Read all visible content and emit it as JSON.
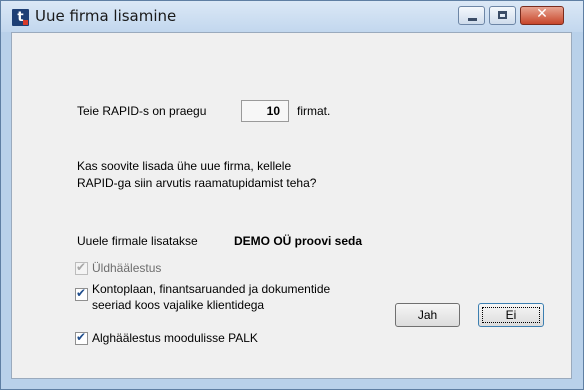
{
  "window": {
    "title": "Uue firma lisamine",
    "icon": "rapid-app-icon",
    "controls": {
      "minimize": "minimize-icon",
      "maximize": "maximize-icon",
      "close": "close-icon"
    }
  },
  "count_line": {
    "prefix": "Teie RAPID-s on  praegu",
    "value": "10",
    "suffix": "firmat."
  },
  "question": {
    "line1": "Kas soovite lisada ühe uue firma, kellele",
    "line2": "RAPID-ga siin arvutis raamatupidamist teha?"
  },
  "new_company": {
    "label": "Uuele firmale lisatakse",
    "name": "DEMO OÜ proovi seda"
  },
  "options": {
    "general": {
      "label": "Üldhäälestus",
      "checked": true,
      "enabled": false
    },
    "chart": {
      "line1": "Kontoplaan, finantsaruanded ja dokumentide",
      "line2": "seeriad koos vajalike klientidega",
      "checked": true,
      "enabled": true
    },
    "payroll": {
      "label": "Alghäälestus moodulisse PALK",
      "checked": true,
      "enabled": true
    }
  },
  "buttons": {
    "yes": "Jah",
    "no": "Ei"
  },
  "colors": {
    "titlebar": "#c8dbf0",
    "close": "#c7462b",
    "client": "#f0f0f0",
    "check": "#1f4d8c"
  }
}
